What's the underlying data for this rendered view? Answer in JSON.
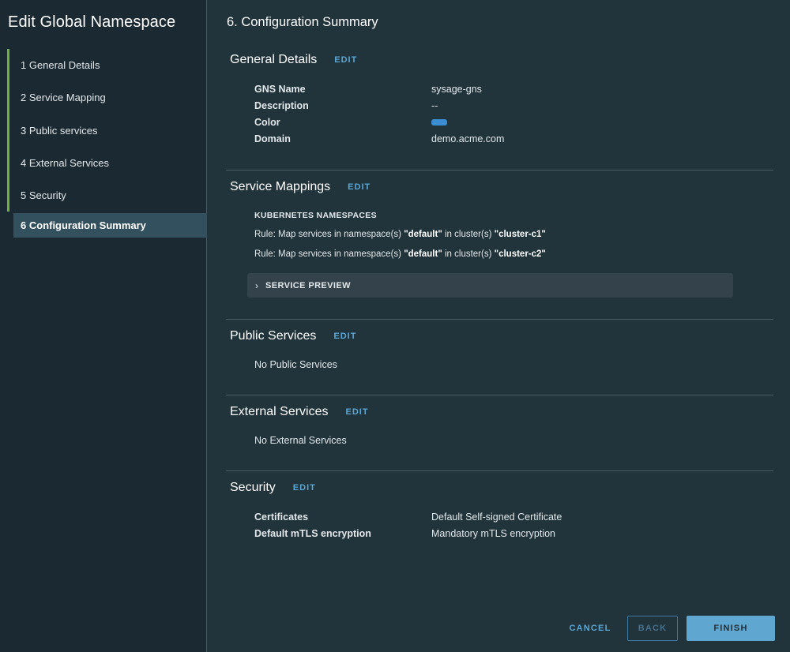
{
  "wizard": {
    "title": "Edit Global Namespace",
    "steps": [
      {
        "label": "1  General Details"
      },
      {
        "label": "2  Service Mapping"
      },
      {
        "label": "3  Public services"
      },
      {
        "label": "4  External Services"
      },
      {
        "label": "5  Security"
      },
      {
        "label": "6  Configuration Summary"
      }
    ]
  },
  "main": {
    "title": "6. Configuration Summary",
    "edit_label": "EDIT",
    "general": {
      "title": "General Details",
      "rows": [
        {
          "key": "GNS Name",
          "value": "sysage-gns"
        },
        {
          "key": "Description",
          "value": "--"
        },
        {
          "key": "Color",
          "value": "#3a8dd1"
        },
        {
          "key": "Domain",
          "value": "demo.acme.com"
        }
      ]
    },
    "service_mappings": {
      "title": "Service Mappings",
      "subheading": "KUBERNETES NAMESPACES",
      "rules": [
        {
          "prefix": "Rule: Map services in namespace(s) ",
          "namespace": "\"default\"",
          "mid": " in cluster(s) ",
          "cluster": "\"cluster-c1\""
        },
        {
          "prefix": "Rule: Map services in namespace(s) ",
          "namespace": "\"default\"",
          "mid": " in cluster(s) ",
          "cluster": "\"cluster-c2\""
        }
      ],
      "preview_label": "SERVICE PREVIEW"
    },
    "public_services": {
      "title": "Public Services",
      "empty_text": "No Public Services"
    },
    "external_services": {
      "title": "External Services",
      "empty_text": "No External Services"
    },
    "security": {
      "title": "Security",
      "rows": [
        {
          "key": "Certificates",
          "value": "Default Self-signed Certificate"
        },
        {
          "key": "Default mTLS encryption",
          "value": "Mandatory mTLS encryption"
        }
      ]
    }
  },
  "footer": {
    "cancel": "CANCEL",
    "back": "BACK",
    "finish": "FINISH"
  }
}
